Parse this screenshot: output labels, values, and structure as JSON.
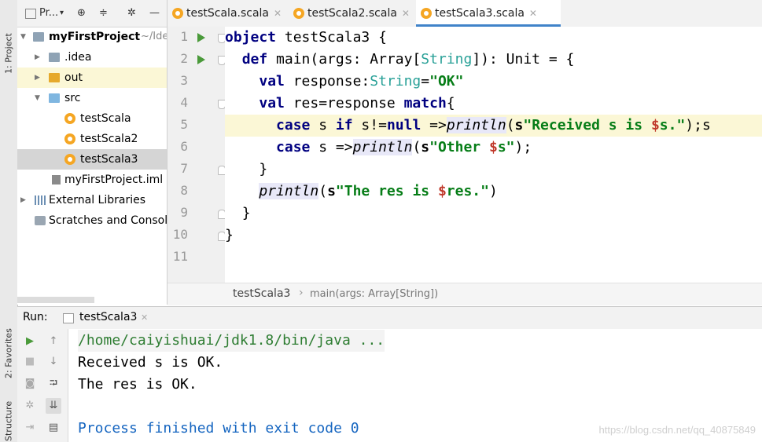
{
  "left_strip": {
    "project_tab": "1: Project",
    "favorites_tab": "2: Favorites",
    "structure_tab": "Structure"
  },
  "project_toolbar": {
    "title": "Pr...",
    "dropdown_icon": "chevron-down-icon",
    "icons": [
      "target-icon",
      "collapse-icon",
      "gear-icon",
      "minimize-icon"
    ]
  },
  "tree": [
    {
      "label": "myFirstProject",
      "suffix": "~/Ide",
      "kind": "project-folder"
    },
    {
      "label": ".idea",
      "kind": "folder"
    },
    {
      "label": "out",
      "kind": "folder-orange"
    },
    {
      "label": "src",
      "kind": "folder-blue"
    },
    {
      "label": "testScala",
      "kind": "scala"
    },
    {
      "label": "testScala2",
      "kind": "scala"
    },
    {
      "label": "testScala3",
      "kind": "scala"
    },
    {
      "label": "myFirstProject.iml",
      "kind": "iml"
    },
    {
      "label": "External Libraries",
      "kind": "libs"
    },
    {
      "label": "Scratches and Consol",
      "kind": "scratches"
    }
  ],
  "editor_tabs": [
    {
      "label": "testScala.scala"
    },
    {
      "label": "testScala2.scala"
    },
    {
      "label": "testScala3.scala"
    }
  ],
  "line_numbers": [
    "1",
    "2",
    "3",
    "4",
    "5",
    "6",
    "7",
    "8",
    "9",
    "10",
    "11"
  ],
  "code": {
    "l1": {
      "kw": "object",
      "rest": " testScala3 {"
    },
    "l2": {
      "indent": "  ",
      "kw": "def",
      "a": " main(args: Array[",
      "type": "String",
      "b": "]): Unit = {"
    },
    "l3": {
      "indent": "    ",
      "kw": "val",
      "a": " response:",
      "type": "String",
      "b": "=",
      "str": "\"OK\""
    },
    "l4": {
      "indent": "    ",
      "kw": "val",
      "a": " res=response ",
      "kw2": "match",
      "b": "{"
    },
    "l5": {
      "indent": "      ",
      "kw": "case",
      "a": " s ",
      "kw2": "if",
      "b": " s!=",
      "kw3": "null",
      "c": " =>",
      "fn": "println",
      "d": "(",
      "s": "s",
      "str1": "\"Received s is ",
      "interp": "$",
      "str2": "s.\"",
      "e": ");s"
    },
    "l6": {
      "indent": "      ",
      "kw": "case",
      "a": " s =>",
      "fn": "println",
      "b": "(",
      "s": "s",
      "str1": "\"Other ",
      "interp": "$",
      "str2": "s\"",
      "c": ");"
    },
    "l7": {
      "indent": "    ",
      "text": "}"
    },
    "l8": {
      "indent": "    ",
      "fn": "println",
      "a": "(",
      "s": "s",
      "str1": "\"The res is ",
      "interp": "$",
      "str2": "res.\"",
      "b": ")"
    },
    "l9": {
      "indent": "  ",
      "text": "}"
    },
    "l10": {
      "text": "}"
    },
    "l11": {
      "text": ""
    }
  },
  "breadcrumb": {
    "file": "testScala3",
    "separator": "›",
    "method": "main(args: Array[String])"
  },
  "run": {
    "label": "Run:",
    "tab": "testScala3",
    "output": [
      "/home/caiyishuai/jdk1.8/bin/java ...",
      "Received s is OK.",
      "The res is OK.",
      "",
      "Process finished with exit code 0"
    ],
    "watermark": "https://blog.csdn.net/qq_40875849"
  },
  "colors": {
    "keyword": "#000080",
    "string": "#067d17",
    "type": "#2aa198",
    "highlight_line": "#fbf7d6",
    "accent": "#4083c9",
    "run_green": "#4a9a3a"
  }
}
